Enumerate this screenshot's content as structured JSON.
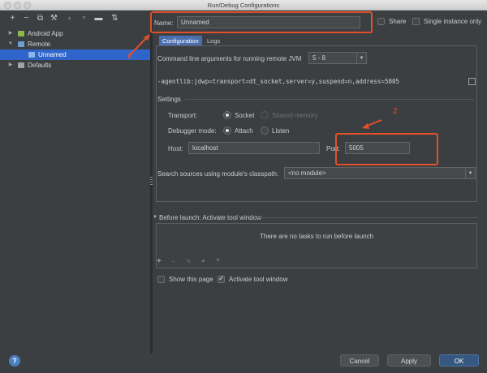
{
  "window": {
    "title": "Run/Debug Configurations"
  },
  "toolbar": {
    "add": "+",
    "remove": "−",
    "copy": "⧉",
    "wrench": "⚒",
    "up": "▲",
    "down": "▼",
    "folder": "▬",
    "sort": "⇅"
  },
  "tree": {
    "items": [
      {
        "label": "Android App",
        "arrow": "▶"
      },
      {
        "label": "Remote",
        "arrow": "▼"
      },
      {
        "label": "Unnamed",
        "arrow": ""
      },
      {
        "label": "Defaults",
        "arrow": "▶"
      }
    ]
  },
  "name_row": {
    "label": "Name:",
    "value": "Unnamed",
    "share_label": "Share",
    "single_instance_label": "Single instance only"
  },
  "tabs": [
    {
      "label": "Configuration"
    },
    {
      "label": "Logs"
    }
  ],
  "config": {
    "cmd_label": "Command line arguments for running remote JVM",
    "jdk_version": "5 - 8",
    "cmd_value": "-agentlib:jdwp=transport=dt_socket,server=y,suspend=n,address=5005",
    "settings_label": "Settings",
    "transport_label": "Transport:",
    "transport_socket": "Socket",
    "transport_shared": "Shared memory",
    "debugger_mode_label": "Debugger mode:",
    "mode_attach": "Attach",
    "mode_listen": "Listen",
    "host_label": "Host:",
    "host_value": "localhost",
    "port_label": "Port:",
    "port_value": "5005",
    "classpath_label": "Search sources using module's classpath:",
    "classpath_value": "<no module>"
  },
  "before_launch": {
    "header": "Before launch: Activate tool window",
    "empty_text": "There are no tasks to run before launch"
  },
  "options": {
    "show_page": "Show this page",
    "activate_tool_window": "Activate tool window"
  },
  "annotations": {
    "one": "1",
    "two": "2"
  },
  "footer": {
    "help": "?",
    "cancel": "Cancel",
    "apply": "Apply",
    "ok": "OK"
  },
  "colors": {
    "accent": "#2f65ca",
    "highlight": "#e2502a",
    "panel": "#3c3f41"
  }
}
